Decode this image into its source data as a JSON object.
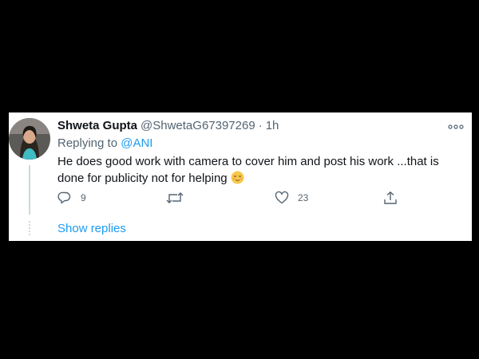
{
  "tweet": {
    "display_name": "Shweta Gupta",
    "handle": "@ShwetaG67397269",
    "separator": "·",
    "time": "1h",
    "replying_to_prefix": "Replying to",
    "replying_to_handle": "@ANI",
    "text": "He does good work with camera to cover him and post his work ...that is done for publicity not for helping",
    "emoji_icon": "relieved-face-icon",
    "actions": {
      "reply_count": "9",
      "retweet_count": "",
      "like_count": "23",
      "share_count": ""
    }
  },
  "show_replies_label": "Show replies",
  "colors": {
    "background": "#000000",
    "card": "#ffffff",
    "link": "#1d9bf0",
    "secondary_text": "#536471",
    "primary_text": "#0f1419"
  }
}
